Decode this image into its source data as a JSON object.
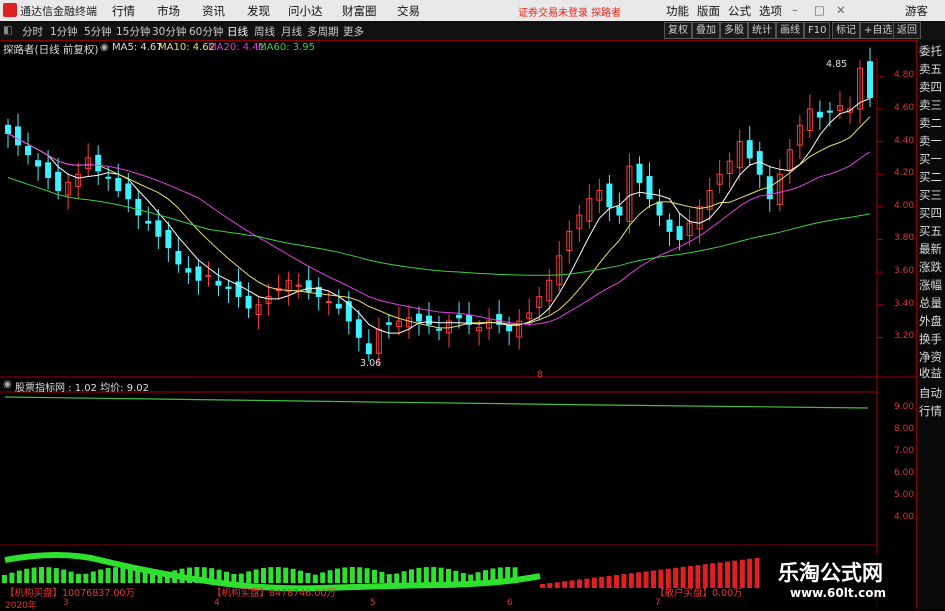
{
  "app": {
    "title": "通达信金融终端"
  },
  "menu": [
    "行情",
    "市场",
    "资讯",
    "发现",
    "问小达",
    "财富圈",
    "交易"
  ],
  "login_warning": "证券交易未登录  探路者",
  "right_menu": [
    "功能",
    "版面",
    "公式",
    "选项"
  ],
  "guest": "游客",
  "periods": [
    "分时",
    "1分钟",
    "5分钟",
    "15分钟",
    "30分钟",
    "60分钟",
    "日线",
    "周线",
    "月线",
    "多周期",
    "更多"
  ],
  "active_period": "日线",
  "tool_buttons": [
    "复权",
    "叠加",
    "多股",
    "统计",
    "画线",
    "F10",
    "标记",
    "+自选",
    "返回"
  ],
  "main_chart": {
    "title": "探路者(日线 前复权)",
    "ma": [
      {
        "label": "MA5: 4.67",
        "color": "#ffffff"
      },
      {
        "label": "MA10: 4.62",
        "color": "#e8e070"
      },
      {
        "label": "MA20: 4.41",
        "color": "#e040e0"
      },
      {
        "label": "MA60: 3.95",
        "color": "#40d040"
      }
    ],
    "y_ticks": [
      "4.80",
      "4.60",
      "4.40",
      "4.20",
      "4.00",
      "3.80",
      "3.60",
      "3.40",
      "3.20"
    ],
    "high_label": "4.85",
    "low_label": "3.06",
    "marker": "8"
  },
  "sub_chart": {
    "title": "股票指标网 : 1.02  均价: 9.02",
    "y_ticks": [
      "9.00",
      "8.00",
      "7.00",
      "6.00",
      "5.00",
      "4.00"
    ]
  },
  "bottom": {
    "inst_buy": "【机构买盘】10076837.00万",
    "inst_buy2": "【机构买盘】8478746.00万",
    "retail_buy": "【散户买盘】0.00万",
    "dates": [
      "2020年",
      "3",
      "4",
      "5",
      "6",
      "7"
    ]
  },
  "side_panel": [
    "委托",
    "卖五",
    "卖四",
    "卖三",
    "卖二",
    "卖一",
    "买一",
    "买二",
    "买三",
    "买四",
    "买五",
    "最新",
    "涨跌",
    "涨幅",
    "总量",
    "外盘",
    "换手",
    "净资",
    "收益",
    "自动",
    "行情"
  ],
  "watermark": {
    "cn": "乐淘公式网",
    "url": "www.60lt.com"
  },
  "chart_data": {
    "type": "candlestick",
    "ylim": [
      3.0,
      4.9
    ],
    "close": [
      4.45,
      4.38,
      4.32,
      4.25,
      4.18,
      4.1,
      4.15,
      4.2,
      4.3,
      4.22,
      4.18,
      4.1,
      4.05,
      3.95,
      3.9,
      3.82,
      3.75,
      3.65,
      3.6,
      3.55,
      3.58,
      3.52,
      3.5,
      3.45,
      3.38,
      3.4,
      3.45,
      3.5,
      3.55,
      3.52,
      3.48,
      3.45,
      3.42,
      3.38,
      3.3,
      3.2,
      3.1,
      3.25,
      3.28,
      3.3,
      3.32,
      3.3,
      3.28,
      3.25,
      3.3,
      3.32,
      3.28,
      3.26,
      3.3,
      3.28,
      3.24,
      3.3,
      3.35,
      3.45,
      3.55,
      3.7,
      3.85,
      3.95,
      4.05,
      4.1,
      4.0,
      3.95,
      4.25,
      4.15,
      4.05,
      3.95,
      3.85,
      3.8,
      3.9,
      4.0,
      4.1,
      4.2,
      4.28,
      4.4,
      4.3,
      4.2,
      4.05,
      4.2,
      4.35,
      4.5,
      4.6,
      4.55,
      4.58,
      4.62,
      4.6,
      4.85,
      4.67
    ]
  }
}
